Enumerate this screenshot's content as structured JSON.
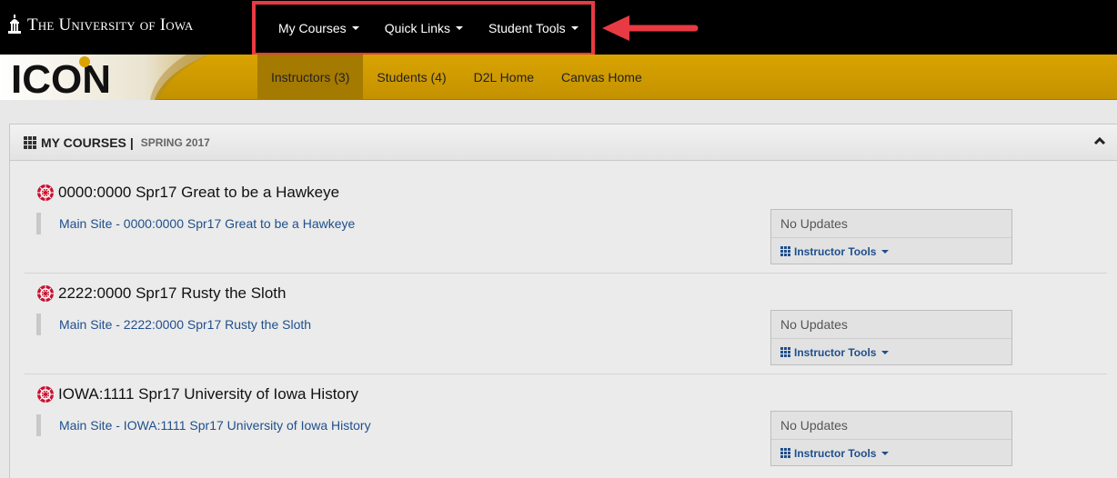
{
  "header": {
    "university_name": "The University of Iowa",
    "nav": [
      {
        "label": "My Courses"
      },
      {
        "label": "Quick Links"
      },
      {
        "label": "Student Tools"
      }
    ],
    "highlight_color": "#e83a42"
  },
  "brand": {
    "logo_text": "ICON",
    "gold_color": "#d9a300"
  },
  "subnav": [
    {
      "label": "Instructors (3)",
      "active": true
    },
    {
      "label": "Students (4)"
    },
    {
      "label": "D2L Home"
    },
    {
      "label": "Canvas Home"
    }
  ],
  "panel": {
    "title": "MY COURSES",
    "separator": "|",
    "term": "SPRING 2017"
  },
  "courses": [
    {
      "title": "0000:0000 Spr17 Great to be a Hawkeye",
      "link": "Main Site - 0000:0000 Spr17 Great to be a Hawkeye",
      "updates": "No Updates",
      "tools": "Instructor Tools"
    },
    {
      "title": "2222:0000 Spr17 Rusty the Sloth",
      "link": "Main Site - 2222:0000 Spr17 Rusty the Sloth",
      "updates": "No Updates",
      "tools": "Instructor Tools"
    },
    {
      "title": "IOWA:1111 Spr17 University of Iowa History",
      "link": "Main Site - IOWA:1111 Spr17 University of Iowa History",
      "updates": "No Updates",
      "tools": "Instructor Tools"
    }
  ]
}
